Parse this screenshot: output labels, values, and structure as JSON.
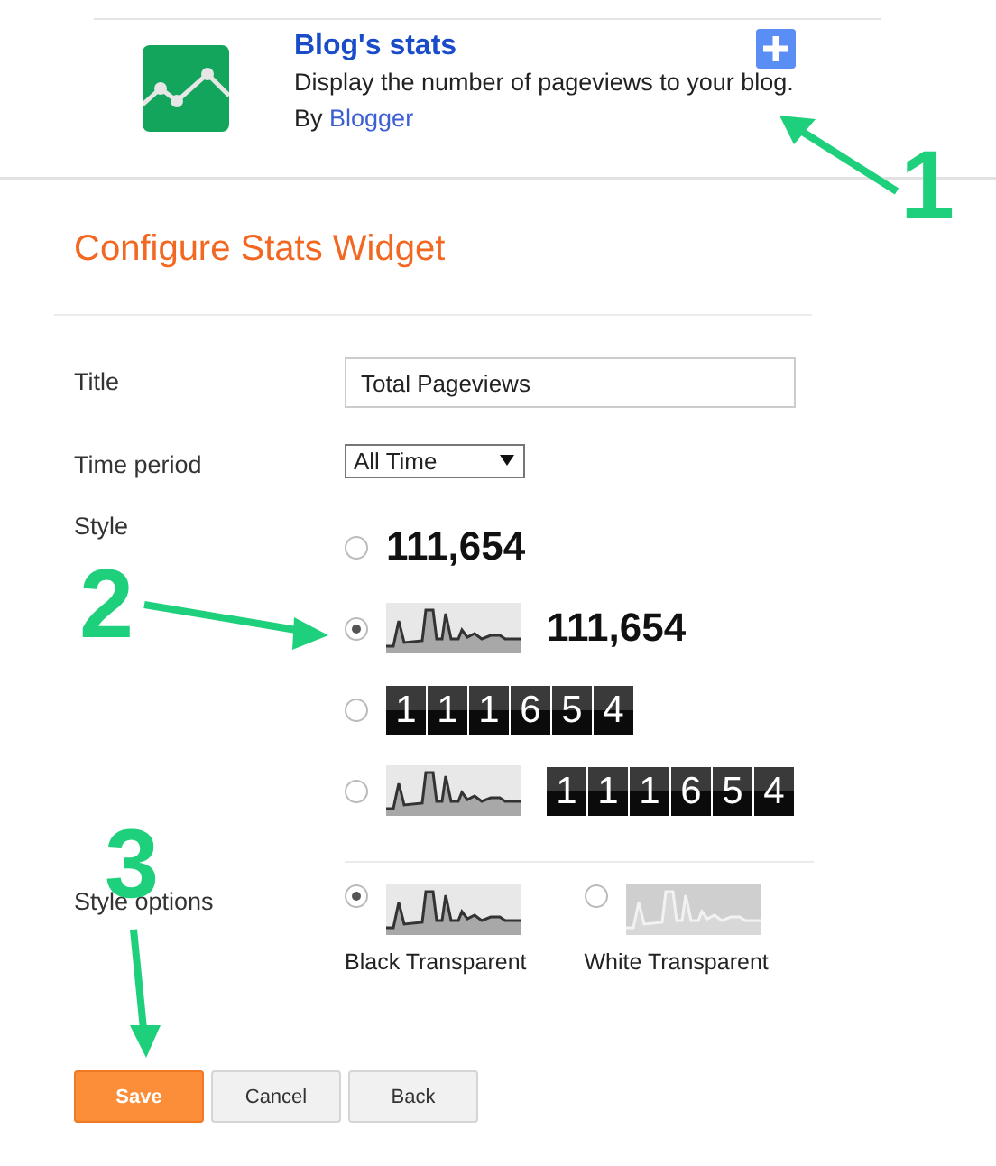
{
  "widget": {
    "title": "Blog's stats",
    "description": "Display the number of pageviews to your blog.",
    "by": "By",
    "author": "Blogger"
  },
  "heading": "Configure Stats Widget",
  "form": {
    "title_label": "Title",
    "title_value": "Total Pageviews",
    "period_label": "Time period",
    "period_value": "All Time",
    "style_label": "Style",
    "styles": [
      {
        "kind": "number",
        "selected": false,
        "number": "111,654"
      },
      {
        "kind": "sparkline-number",
        "selected": true,
        "number": "111,654"
      },
      {
        "kind": "counter",
        "selected": false,
        "digits": [
          "1",
          "1",
          "1",
          "6",
          "5",
          "4"
        ]
      },
      {
        "kind": "sparkline-counter",
        "selected": false,
        "digits": [
          "1",
          "1",
          "1",
          "6",
          "5",
          "4"
        ]
      }
    ],
    "options_label": "Style options",
    "options": [
      {
        "kind": "black",
        "selected": true,
        "label": "Black Transparent"
      },
      {
        "kind": "white",
        "selected": false,
        "label": "White Transparent"
      }
    ]
  },
  "buttons": [
    {
      "label": "Save",
      "kind": "primary"
    },
    {
      "label": "Cancel",
      "kind": "default"
    },
    {
      "label": "Back",
      "kind": "default"
    }
  ],
  "annotations": [
    {
      "label": "1"
    },
    {
      "label": "2"
    },
    {
      "label": "3"
    }
  ]
}
